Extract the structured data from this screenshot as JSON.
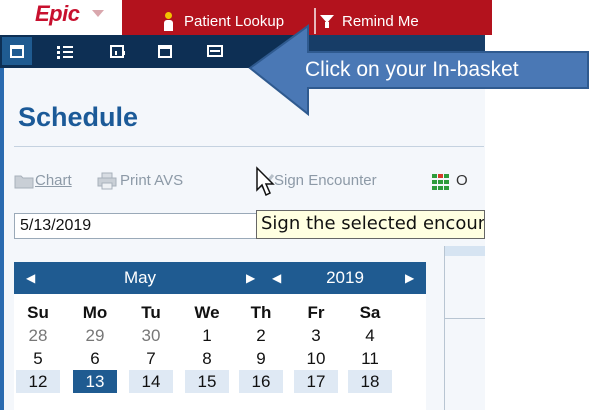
{
  "app": {
    "logo_text": "Epic",
    "tabs": [
      "Patient Lookup",
      "Remind Me"
    ]
  },
  "toolbar": {
    "icons": [
      "calendar-icon",
      "patient-list-icon",
      "report-icon",
      "window-icon",
      "in-basket-icon"
    ]
  },
  "callout": {
    "text": "Click on your In-basket"
  },
  "schedule": {
    "title": "Schedule",
    "actions": {
      "chart": "Chart",
      "print_avs": "Print AVS",
      "sign_encounter": "Sign Encounter",
      "order_partial": "O"
    },
    "date_value": "5/13/2019",
    "tooltip": "Sign the selected encounter"
  },
  "calendar": {
    "month": "May",
    "year": "2019",
    "weekdays": [
      "Su",
      "Mo",
      "Tu",
      "We",
      "Th",
      "Fr",
      "Sa"
    ],
    "weeks": [
      [
        "28",
        "29",
        "30",
        "1",
        "2",
        "3",
        "4"
      ],
      [
        "5",
        "6",
        "7",
        "8",
        "9",
        "10",
        "11"
      ],
      [
        "12",
        "13",
        "14",
        "15",
        "16",
        "17",
        "18"
      ]
    ],
    "selected": "13"
  },
  "colors": {
    "epic_red": "#b3121d",
    "toolbar_navy": "#0d2f54",
    "callout_blue": "#4a78b5",
    "calendar_blue": "#1f5b91"
  }
}
